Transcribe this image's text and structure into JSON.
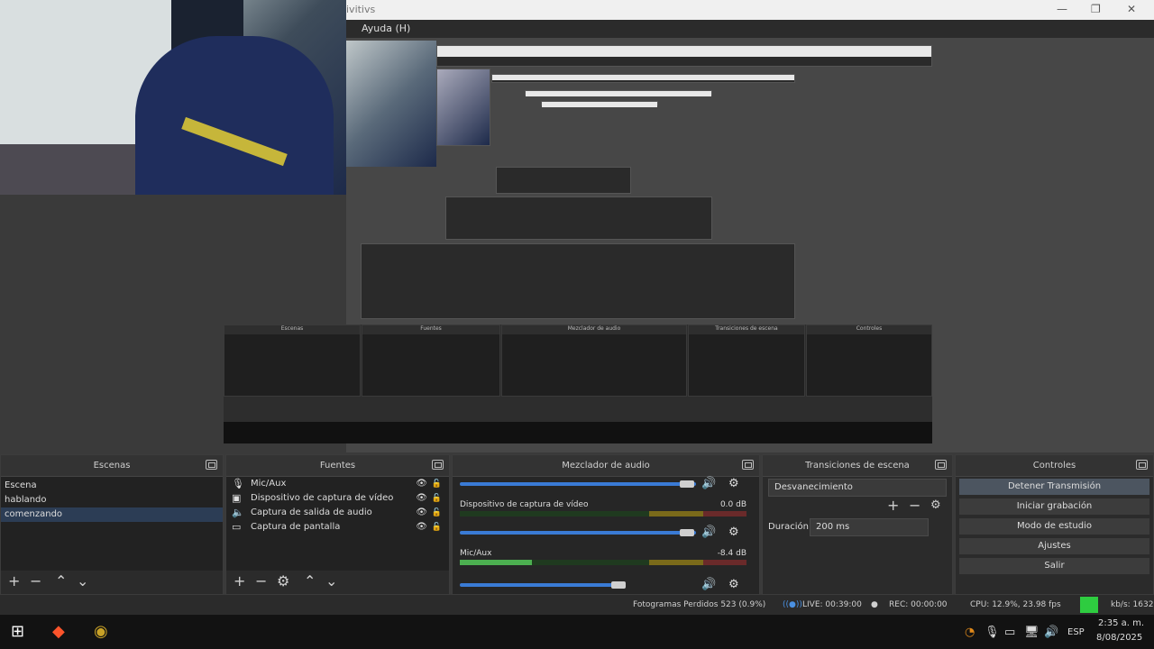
{
  "window": {
    "title": "ivitivs",
    "menu_item": "Ayuda (H)",
    "minimize": "—",
    "maximize": "❐",
    "close": "✕"
  },
  "scenes": {
    "title": "Escenas",
    "items": [
      "Escena",
      "hablando",
      "comenzando"
    ],
    "selected_index": 2,
    "add": "+",
    "remove": "−",
    "up": "⌃",
    "down": "⌄"
  },
  "sources": {
    "title": "Fuentes",
    "items": [
      {
        "icon": "mic-icon",
        "glyph": "🎙",
        "label": "Mic/Aux"
      },
      {
        "icon": "camera-icon",
        "glyph": "▣",
        "label": "Dispositivo de captura de vídeo"
      },
      {
        "icon": "speaker-icon",
        "glyph": "🔈",
        "label": "Captura de salida de audio"
      },
      {
        "icon": "monitor-icon",
        "glyph": "▭",
        "label": "Captura de pantalla"
      }
    ],
    "add": "+",
    "remove": "−",
    "settings": "⚙",
    "up": "⌃",
    "down": "⌄"
  },
  "mixer": {
    "title": "Mezclador de audio",
    "channels": [
      {
        "name": "Dispositivo de captura de vídeo",
        "db": "0.0 dB",
        "level": 0.0
      },
      {
        "name": "Mic/Aux",
        "db": "-8.4 dB",
        "level": 0.25
      }
    ]
  },
  "transitions": {
    "title": "Transiciones de escena",
    "selected": "Desvanecimiento",
    "duration_label": "Duración",
    "duration_value": "200 ms"
  },
  "controls": {
    "title": "Controles",
    "buttons": [
      "Detener Transmisión",
      "Iniciar grabación",
      "Modo de estudio",
      "Ajustes",
      "Salir"
    ]
  },
  "status": {
    "dropped": "Fotogramas Perdidos 523 (0.9%)",
    "live": "LIVE: 00:39:00",
    "rec": "REC: 00:00:00",
    "cpu": "CPU: 12.9%, 23.98 fps",
    "kbps": "kb/s: 1632"
  },
  "taskbar": {
    "lang": "ESP",
    "time": "2:35 a. m.",
    "date": "8/08/2025"
  },
  "colors": {
    "accent": "#3a7bd5",
    "live_green": "#2ecc40",
    "brave_orange": "#fb542b",
    "obs_yellow": "#c9a227"
  }
}
